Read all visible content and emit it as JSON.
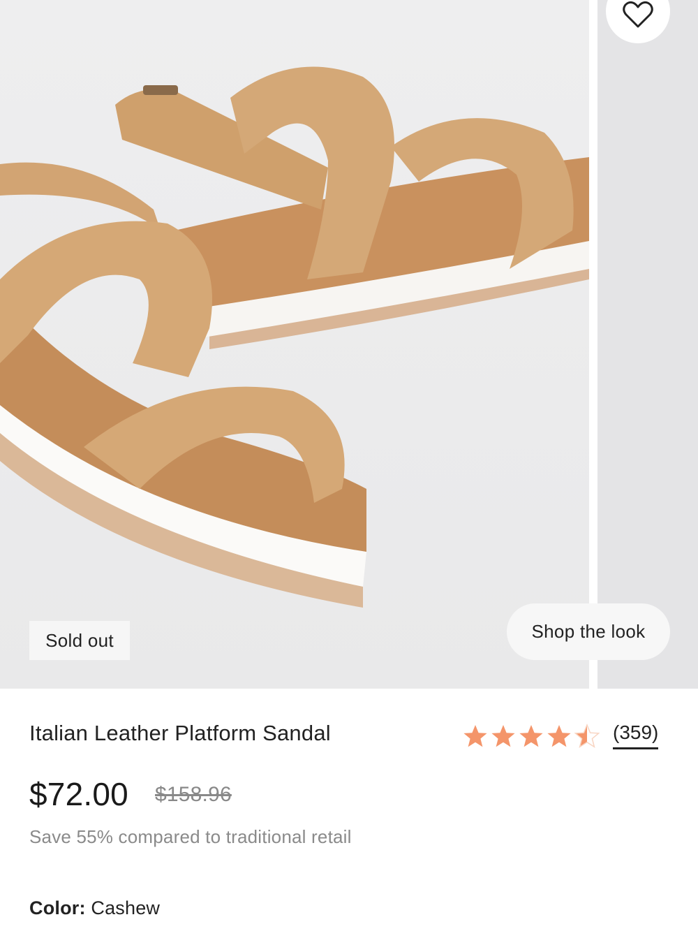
{
  "gallery": {
    "sold_out_label": "Sold out",
    "shop_the_look_label": "Shop the look",
    "favorite_icon": "heart-icon"
  },
  "product": {
    "title": "Italian Leather Platform Sandal",
    "rating": 4.5,
    "rating_max": 5,
    "review_count": "(359)",
    "price": "$72.00",
    "retail_price": "$158.96",
    "savings_text": "Save 55% compared to traditional retail",
    "color_label": "Color:",
    "color_value": "Cashew"
  },
  "colors": {
    "star": "#f4956a",
    "leather": "#d2a777",
    "sole": "#ffffff"
  }
}
